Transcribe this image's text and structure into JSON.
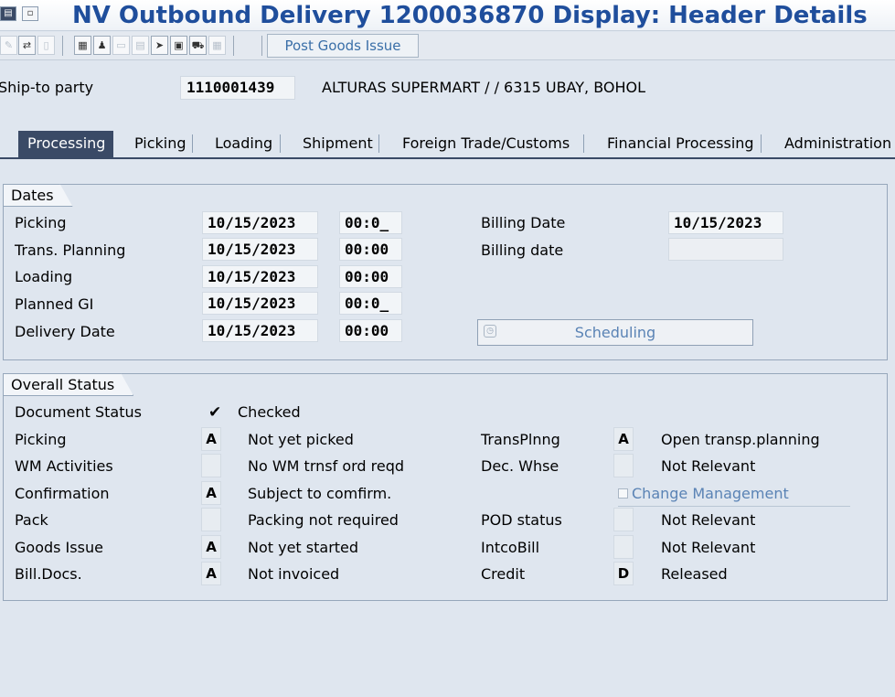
{
  "window": {
    "title": "NV Outbound Delivery 1200036870 Display: Header Details"
  },
  "toolbar": {
    "post_goods_issue": "Post Goods Issue"
  },
  "header": {
    "shipto_label": "Ship-to party",
    "shipto_value": "1110001439",
    "shipto_desc": "ALTURAS SUPERMART / / 6315 UBAY, BOHOL"
  },
  "tabs": [
    {
      "label": "Processing",
      "active": true
    },
    {
      "label": "Picking"
    },
    {
      "label": "Loading"
    },
    {
      "label": "Shipment"
    },
    {
      "label": "Foreign Trade/Customs"
    },
    {
      "label": "Financial Processing"
    },
    {
      "label": "Administration"
    }
  ],
  "dates": {
    "title": "Dates",
    "rows": [
      {
        "label": "Picking",
        "date": "10/15/2023",
        "time": "00:0_"
      },
      {
        "label": "Trans. Planning",
        "date": "10/15/2023",
        "time": "00:00"
      },
      {
        "label": "Loading",
        "date": "10/15/2023",
        "time": "00:00"
      },
      {
        "label": "Planned GI",
        "date": "10/15/2023",
        "time": "00:0_"
      },
      {
        "label": "Delivery Date",
        "date": "10/15/2023",
        "time": "00:00"
      }
    ],
    "billing_date_label": "Billing Date",
    "billing_date_value": "10/15/2023",
    "billing_date2_label": "Billing date",
    "billing_date2_value": "",
    "scheduling_button": "Scheduling"
  },
  "overall_status": {
    "title": "Overall Status",
    "document_status_label": "Document Status",
    "document_status_icon": "checkmark-icon",
    "document_status_text": "Checked",
    "left": [
      {
        "label": "Picking",
        "code": "A",
        "text": "Not yet picked"
      },
      {
        "label": "WM Activities",
        "code": "",
        "text": "No WM trnsf ord reqd"
      },
      {
        "label": "Confirmation",
        "code": "A",
        "text": "Subject to comfirm."
      },
      {
        "label": "Pack",
        "code": "",
        "text": "Packing not required"
      },
      {
        "label": "Goods Issue",
        "code": "A",
        "text": "Not yet started"
      },
      {
        "label": "Bill.Docs.",
        "code": "A",
        "text": "Not invoiced"
      }
    ],
    "right": [
      {
        "label": "TransPlnng",
        "code": "A",
        "text": "Open transp.planning"
      },
      {
        "label": "Dec. Whse",
        "code": "",
        "text": "Not Relevant"
      },
      {
        "label": "POD status",
        "code": "",
        "text": "Not Relevant"
      },
      {
        "label": "IntcoBill",
        "code": "",
        "text": "Not Relevant"
      },
      {
        "label": "Credit",
        "code": "D",
        "text": "Released"
      }
    ],
    "change_management_label": "Change Management"
  }
}
